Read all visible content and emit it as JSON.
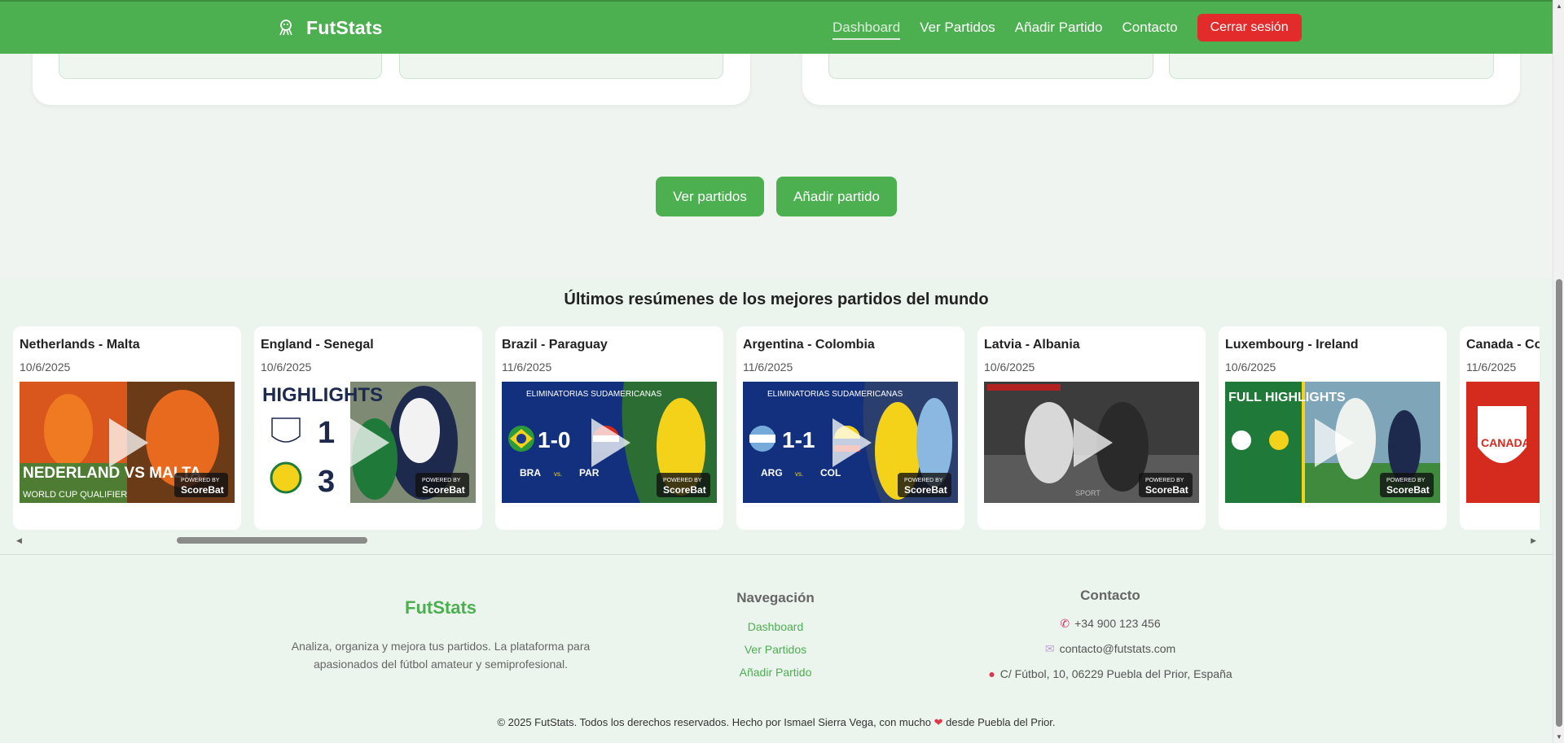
{
  "navbar": {
    "brand": "FutStats",
    "links": [
      "Dashboard",
      "Ver Partidos",
      "Añadir Partido",
      "Contacto"
    ],
    "logout": "Cerrar sesión"
  },
  "actions": {
    "view_matches": "Ver partidos",
    "add_match": "Añadir partido"
  },
  "highlights": {
    "title": "Últimos resúmenes de los mejores partidos del mundo",
    "cards": [
      {
        "title": "Netherlands - Malta",
        "date": "10/6/2025",
        "thumb_text": "NEDERLAND VS MALTA",
        "thumb_sub": "WORLD CUP QUALIFIER"
      },
      {
        "title": "England - Senegal",
        "date": "10/6/2025",
        "thumb_text": "HIGHLIGHTS",
        "score_a": "1",
        "score_b": "3"
      },
      {
        "title": "Brazil - Paraguay",
        "date": "11/6/2025",
        "thumb_text": "ELIMINATORIAS SUDAMERICANAS",
        "score": "1-0",
        "team_a": "BRA",
        "team_b": "PAR",
        "vs": "vs."
      },
      {
        "title": "Argentina - Colombia",
        "date": "11/6/2025",
        "thumb_text": "ELIMINATORIAS SUDAMERICANAS",
        "score": "1-1",
        "team_a": "ARG",
        "team_b": "COL",
        "vs": "vs."
      },
      {
        "title": "Latvia - Albania",
        "date": "10/6/2025",
        "thumb_text": "SPORT"
      },
      {
        "title": "Luxembourg - Ireland",
        "date": "10/6/2025",
        "thumb_text": "FULL HIGHLIGHTS"
      },
      {
        "title": "Canada - Co",
        "date": "11/6/2025",
        "thumb_text": "CANADA"
      }
    ],
    "powered_by": "POWERED BY",
    "scorebat": "ScoreBat"
  },
  "footer": {
    "brand": "FutStats",
    "description": "Analiza, organiza y mejora tus partidos. La plataforma para apasionados del fútbol amateur y semiprofesional.",
    "nav_title": "Navegación",
    "nav_links": [
      "Dashboard",
      "Ver Partidos",
      "Añadir Partido"
    ],
    "contact_title": "Contacto",
    "phone": "+34 900 123 456",
    "email": "contacto@futstats.com",
    "address": "C/ Fútbol, 10, 06229 Puebla del Prior, España",
    "copyright_pre": "© 2025 FutStats. Todos los derechos reservados. Hecho por Ismael Sierra Vega, con mucho",
    "copyright_post": "desde Puebla del Prior."
  },
  "colors": {
    "primary": "#4caf50",
    "danger": "#e32b2b",
    "background": "#f0f4f1"
  },
  "icons": [
    "trophy-icon",
    "play-icon",
    "phone-icon",
    "email-icon",
    "location-icon",
    "heart-icon"
  ]
}
